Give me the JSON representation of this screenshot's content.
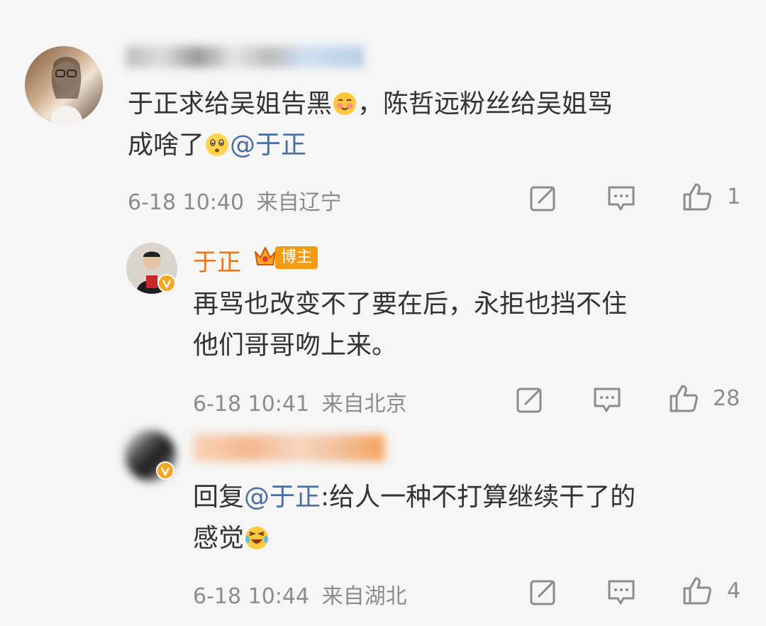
{
  "comment1": {
    "text": "于正求给吴姐告黑",
    "text2": "，陈哲远粉丝给吴姐骂",
    "text3": "成啥了",
    "mention": "@于正",
    "time": "6-18 10:40",
    "location": "来自辽宁",
    "likes": "1"
  },
  "reply1": {
    "username": "于正",
    "badge": "博主",
    "line1": "再骂也改变不了要在后，永拒也挡不住",
    "line2": "他们哥哥吻上来。",
    "time": "6-18 10:41",
    "location": "来自北京",
    "likes": "28"
  },
  "reply2": {
    "prefix": "回复",
    "mention": "@于正",
    "text": ":给人一种不打算继续干了的",
    "text2": "感觉",
    "time": "6-18 10:44",
    "location": "来自湖北",
    "likes": "4"
  },
  "colors": {
    "background": "#f6f6f6",
    "mention": "#4a6fa5",
    "username_orange": "#e8761d",
    "meta_gray": "#8c8c8c"
  },
  "icons": [
    "share-icon",
    "comment-icon",
    "like-icon",
    "verified-icon",
    "crown-icon",
    "emoji-blush",
    "emoji-surprised",
    "emoji-laughing"
  ]
}
